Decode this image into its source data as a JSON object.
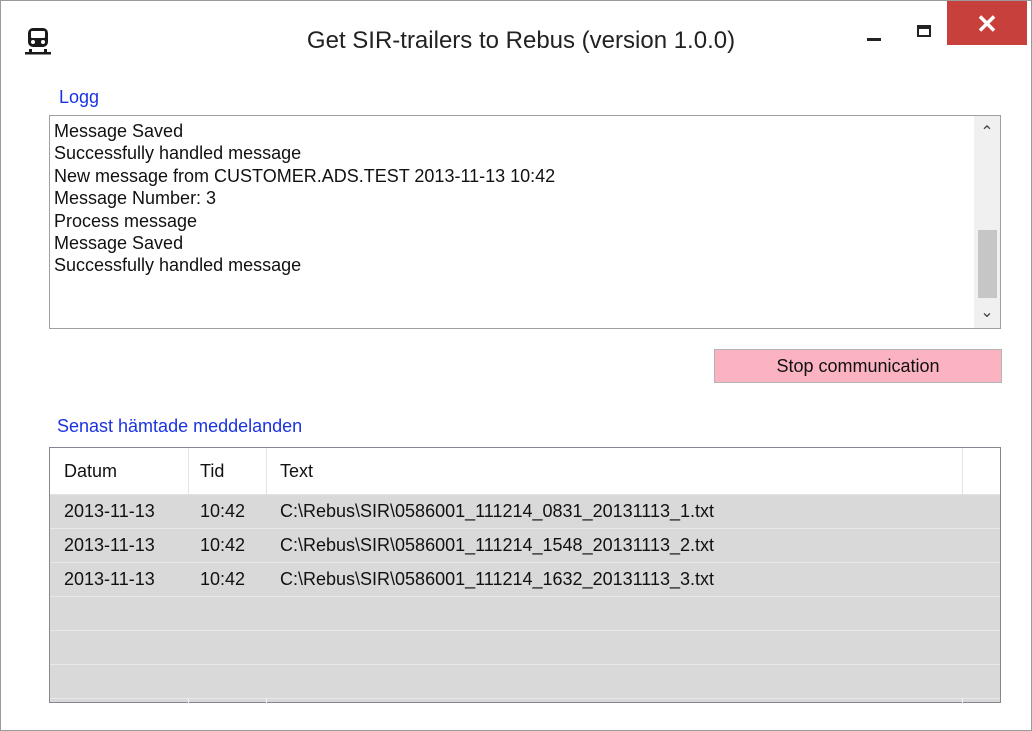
{
  "window": {
    "title": "Get SIR-trailers to Rebus (version 1.0.0)",
    "icon": "train-icon",
    "close_glyph": "✕"
  },
  "log": {
    "label": "Logg",
    "lines": [
      "Message Saved",
      "Successfully handled message",
      "New message from CUSTOMER.ADS.TEST 2013-11-13 10:42",
      "Message Number: 3",
      "Process message",
      "Message Saved",
      "Successfully handled message"
    ],
    "scroll_up": "⌃",
    "scroll_down": "⌄"
  },
  "controls": {
    "stop_label": "Stop communication",
    "stop_color": "#fbb3c2"
  },
  "recent": {
    "label": "Senast hämtade meddelanden",
    "columns": [
      "Datum",
      "Tid",
      "Text"
    ],
    "rows": [
      [
        "2013-11-13",
        "10:42",
        "C:\\Rebus\\SIR\\0586001_111214_0831_20131113_1.txt"
      ],
      [
        "2013-11-13",
        "10:42",
        "C:\\Rebus\\SIR\\0586001_111214_1548_20131113_2.txt"
      ],
      [
        "2013-11-13",
        "10:42",
        "C:\\Rebus\\SIR\\0586001_111214_1632_20131113_3.txt"
      ],
      [
        "",
        "",
        ""
      ],
      [
        "",
        "",
        ""
      ],
      [
        "",
        "",
        ""
      ]
    ]
  },
  "colors": {
    "label_blue": "#1a33e0",
    "close_red": "#c8403c"
  }
}
